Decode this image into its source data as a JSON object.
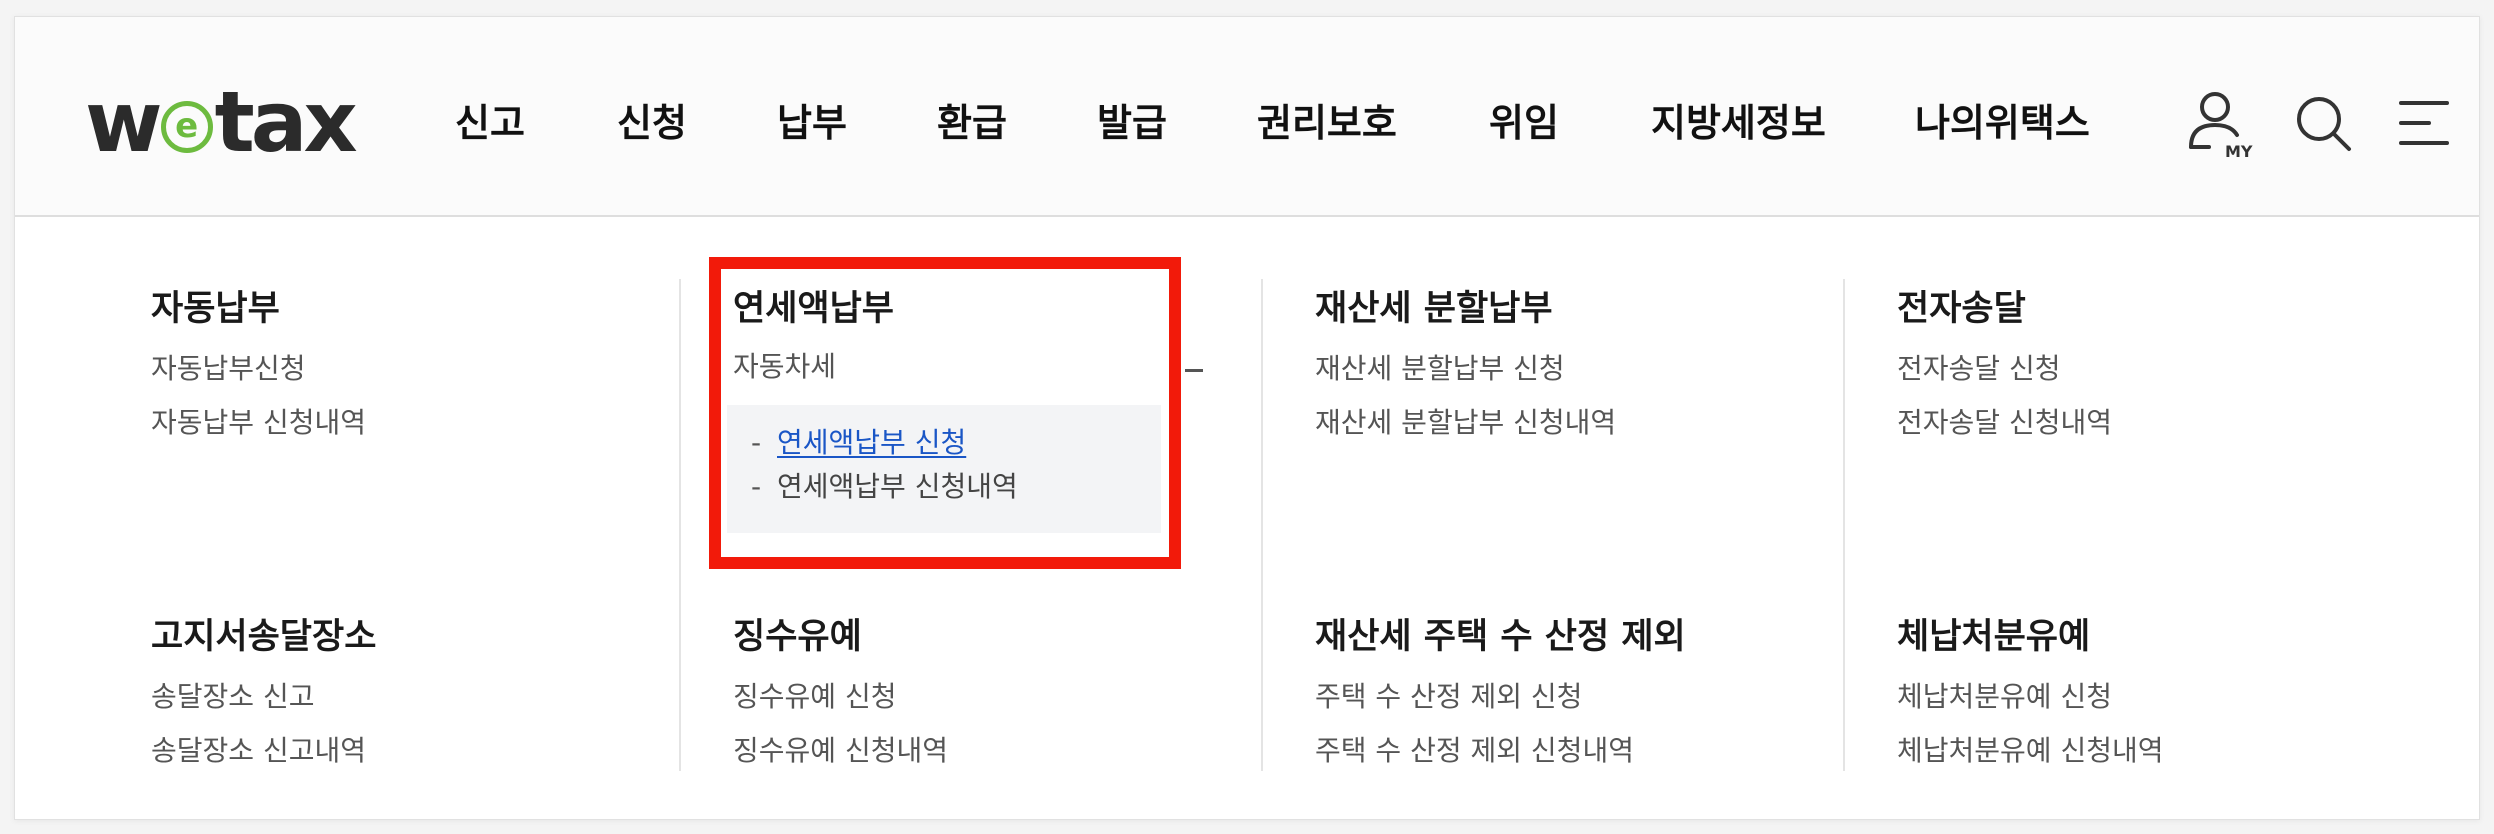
{
  "logo": {
    "pre": "w",
    "mid": "e",
    "post": "tax"
  },
  "nav": [
    "신고",
    "신청",
    "납부",
    "환급",
    "발급",
    "권리보호",
    "위임",
    "지방세정보",
    "나의위택스"
  ],
  "header_icons": [
    "user-my-icon",
    "search-icon",
    "menu-icon"
  ],
  "menu": {
    "sections": [
      {
        "title": "자동납부",
        "links": [
          "자동납부신청",
          "자동납부 신청내역"
        ]
      },
      {
        "title": "연세액납부",
        "links": [
          "자동차세"
        ],
        "sublinks": [
          "연세액납부 신청",
          "연세액납부 신청내역"
        ]
      },
      {
        "title": "재산세 분할납부",
        "links": [
          "재산세 분할납부 신청",
          "재산세 분할납부 신청내역"
        ]
      },
      {
        "title": "전자송달",
        "links": [
          "전자송달 신청",
          "전자송달 신청내역"
        ]
      },
      {
        "title": "고지서송달장소",
        "links": [
          "송달장소 신고",
          "송달장소 신고내역"
        ]
      },
      {
        "title": "징수유예",
        "links": [
          "징수유예 신청",
          "징수유예 신청내역"
        ]
      },
      {
        "title": "재산세 주택 수 산정 제외",
        "links": [
          "주택 수 산정 제외 신청",
          "주택 수 산정 제외 신청내역"
        ]
      },
      {
        "title": "체납처분유예",
        "links": [
          "체납처분유예 신청",
          "체납처분유예 신청내역"
        ]
      }
    ]
  },
  "colors": {
    "highlight": "#f21a0a",
    "active_link": "#1a56c6",
    "logo_green": "#6dbb3f"
  }
}
